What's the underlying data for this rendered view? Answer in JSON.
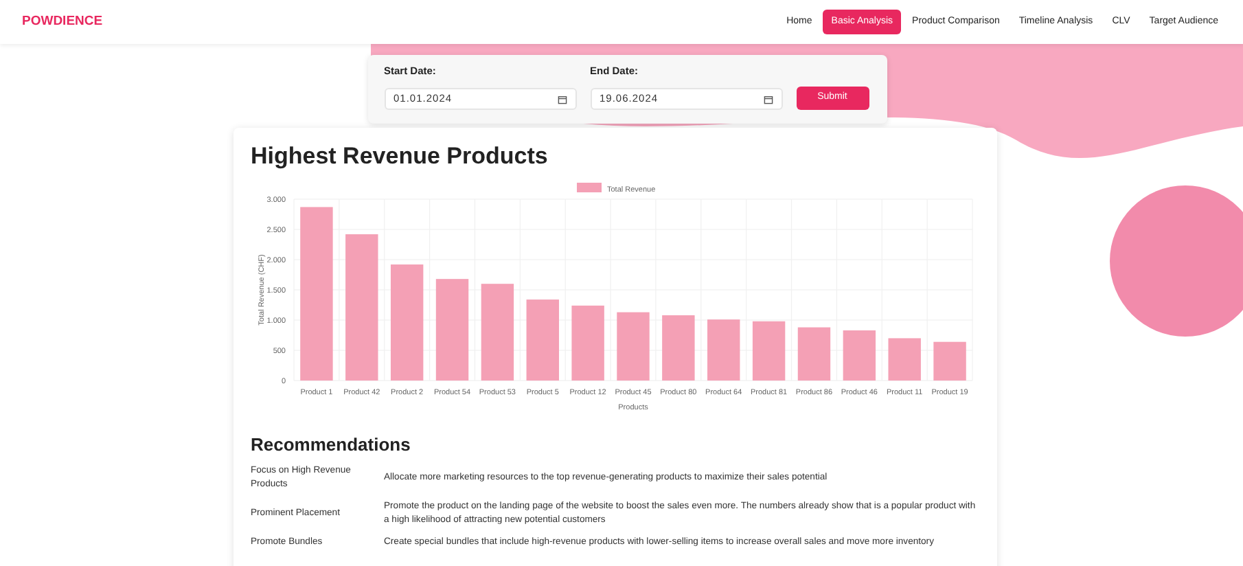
{
  "brand": "POWDIENCE",
  "nav": [
    {
      "label": "Home",
      "selected": false
    },
    {
      "label": "Basic Analysis",
      "selected": true
    },
    {
      "label": "Product Comparison",
      "selected": false
    },
    {
      "label": "Timeline Analysis",
      "selected": false
    },
    {
      "label": "CLV",
      "selected": false
    },
    {
      "label": "Target Audience",
      "selected": false
    }
  ],
  "filters": {
    "start": {
      "label": "Start Date:",
      "value": "01.01.2024"
    },
    "end": {
      "label": "End Date:",
      "value": "19.06.2024"
    },
    "submit": "Submit"
  },
  "title": "Highest Revenue Products",
  "chart_data": {
    "type": "bar",
    "xlabel": "Products",
    "ylabel": "Total Revenue (CHF)",
    "categories": [
      "Product 1",
      "Product 42",
      "Product 2",
      "Product 54",
      "Product 53",
      "Product 5",
      "Product 12",
      "Product 45",
      "Product 80",
      "Product 64",
      "Product 81",
      "Product 86",
      "Product 46",
      "Product 11",
      "Product 19"
    ],
    "series": [
      {
        "name": "Total Revenue",
        "color": "#f4a0b5",
        "values": [
          2870,
          2420,
          1920,
          1680,
          1600,
          1340,
          1240,
          1130,
          1080,
          1010,
          980,
          880,
          830,
          700,
          640
        ]
      }
    ],
    "ylim": [
      0,
      3000
    ],
    "grid": true,
    "yticks": [
      {
        "value": 0,
        "label": "0"
      },
      {
        "value": 500,
        "label": "500"
      },
      {
        "value": 1000,
        "label": "1.000"
      },
      {
        "value": 1500,
        "label": "1.500"
      },
      {
        "value": 2000,
        "label": "2.000"
      },
      {
        "value": 2500,
        "label": "2.500"
      },
      {
        "value": 3000,
        "label": "3.000"
      }
    ]
  },
  "recommendations_title": "Recommendations",
  "recommendations": [
    {
      "name": "Focus on High Revenue Products",
      "text": "Allocate more marketing resources to the top revenue-generating products to maximize their sales potential"
    },
    {
      "name": "Prominent Placement",
      "text": "Promote the product on the landing page of the website to boost the sales even more. The numbers already show that is a popular product with a high likelihood of attracting new potential customers"
    },
    {
      "name": "Promote Bundles",
      "text": "Create special bundles that include high-revenue products with lower-selling items to increase overall sales and move more inventory"
    }
  ]
}
